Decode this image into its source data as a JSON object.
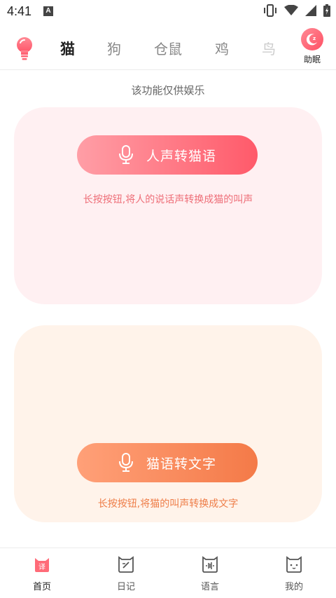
{
  "status_bar": {
    "time": "4:41",
    "app_badge": "A"
  },
  "top_bar": {
    "tabs": [
      {
        "label": "猫",
        "state": "active"
      },
      {
        "label": "狗",
        "state": "normal"
      },
      {
        "label": "仓鼠",
        "state": "normal"
      },
      {
        "label": "鸡",
        "state": "normal"
      },
      {
        "label": "鸟",
        "state": "faded"
      }
    ],
    "sleep_label": "助眠"
  },
  "notice": "该功能仅供娱乐",
  "human_to_cat": {
    "button_label": "人声转猫语",
    "hint": "长按按钮,将人的说话声转换成猫的叫声"
  },
  "cat_to_text": {
    "button_label": "猫语转文字",
    "hint": "长按按钮,将猫的叫声转换成文字"
  },
  "bottom_nav": {
    "items": [
      {
        "label": "首页",
        "icon": "home-cat-icon",
        "badge": "译",
        "active": true
      },
      {
        "label": "日记",
        "icon": "diary-icon",
        "active": false
      },
      {
        "label": "语言",
        "icon": "language-icon",
        "active": false
      },
      {
        "label": "我的",
        "icon": "profile-cat-icon",
        "active": false
      }
    ]
  },
  "colors": {
    "pink_card": "#fff0f2",
    "orange_card": "#fff3ea",
    "pink_accent": "#ff5a6a",
    "orange_accent": "#f47a48"
  }
}
